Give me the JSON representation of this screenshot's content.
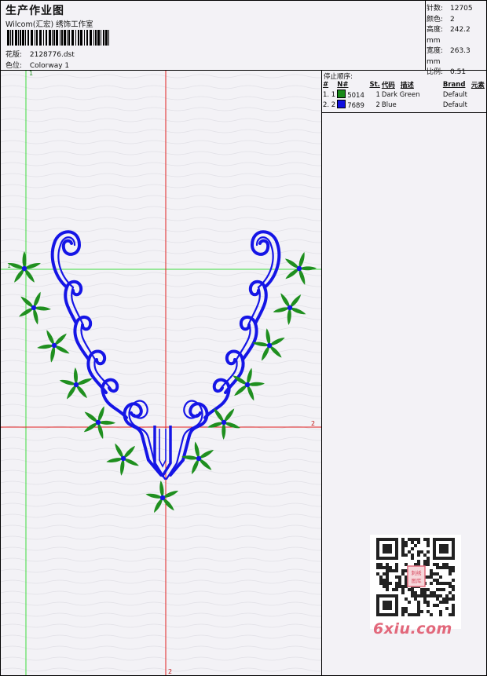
{
  "header": {
    "title": "生产作业图",
    "company": "Wilcom(汇宏) 绣饰工作室",
    "design_label": "花版:",
    "design_value": "2128776.dst",
    "colorway_label": "色位:",
    "colorway_value": "Colorway 1"
  },
  "stats": [
    {
      "label": "针数:",
      "value": "12705"
    },
    {
      "label": "颜色:",
      "value": "2"
    },
    {
      "label": "高度:",
      "value": "242.2 mm"
    },
    {
      "label": "宽度:",
      "value": "263.3 mm"
    },
    {
      "label": "比例:",
      "value": "0.51"
    }
  ],
  "stop_sequence": {
    "label": "停止顺序:",
    "columns": [
      "#",
      "N#",
      "St.",
      "代码",
      "描述",
      "Brand",
      "元素"
    ],
    "rows": [
      {
        "num": "1. 1",
        "code": "5014",
        "stops": "1",
        "desc": "Dark Green",
        "brand": "Default",
        "color": "#1a8a1a"
      },
      {
        "num": "2. 2",
        "code": "7689",
        "stops": "2",
        "desc": "Blue",
        "brand": "Default",
        "color": "#1010e0"
      }
    ]
  },
  "guides": {
    "green_v": "1",
    "green_h": "1",
    "red_v": "2",
    "red_h": "2"
  },
  "colors": {
    "green_thread": "#1f8f1f",
    "blue_thread": "#1515e6",
    "guide_green": "#3ddc3d",
    "guide_red": "#e02020"
  },
  "watermark": {
    "site": "6xiu.com",
    "stamp": "刺绣图库"
  }
}
